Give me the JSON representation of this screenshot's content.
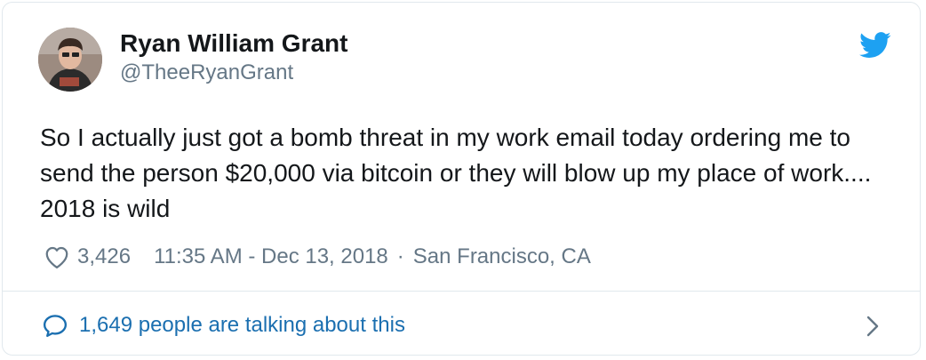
{
  "author": {
    "name": "Ryan William Grant",
    "handle": "@TheeRyanGrant"
  },
  "icons": {
    "brand": "twitter-bird-icon",
    "like": "heart-icon",
    "conversation": "speech-bubble-icon",
    "open": "chevron-right-icon"
  },
  "tweet": {
    "text": "So I actually just got a bomb threat in my work email today ordering me to send the person $20,000 via bitcoin or they will blow up my place of work.... 2018 is wild",
    "likes": "3,426",
    "timestamp": "11:35 AM - Dec 13, 2018",
    "separator": "·",
    "location": "San Francisco, CA"
  },
  "footer": {
    "talking_label": "1,649 people are talking about this"
  },
  "colors": {
    "text": "#14171a",
    "secondary": "#657786",
    "accent": "#1da1f2",
    "link": "#1b6fb0",
    "border": "#e1e8ed"
  }
}
